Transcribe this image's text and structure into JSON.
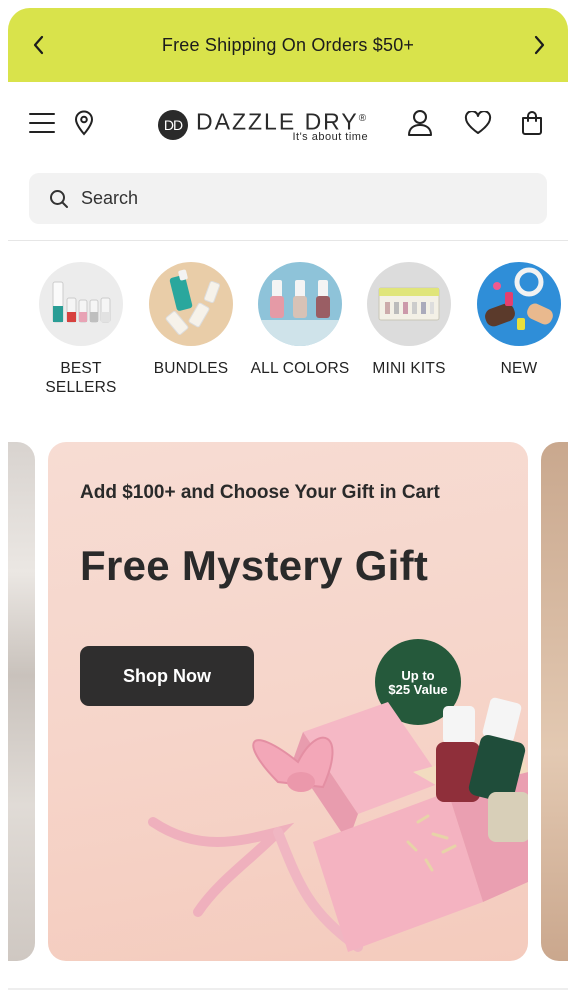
{
  "announcement": {
    "text": "Free Shipping On Orders $50+"
  },
  "header": {
    "logo_badge": "DD",
    "logo_name": "DAZZLE DRY",
    "logo_mark": "®",
    "logo_tagline": "It's about time"
  },
  "search": {
    "placeholder": "Search"
  },
  "categories": [
    {
      "label": "BEST SELLERS"
    },
    {
      "label": "BUNDLES"
    },
    {
      "label": "ALL COLORS"
    },
    {
      "label": "MINI KITS"
    },
    {
      "label": "NEW"
    }
  ],
  "banner": {
    "subtitle": "Add $100+ and Choose Your Gift in Cart",
    "title": "Free Mystery Gift",
    "button_label": "Shop Now",
    "badge_line1": "Up to",
    "badge_line2": "$25 Value"
  },
  "colors": {
    "announce_bg": "#d9e34b",
    "badge_green": "#25593b",
    "button_dark": "#2f2e2e"
  }
}
